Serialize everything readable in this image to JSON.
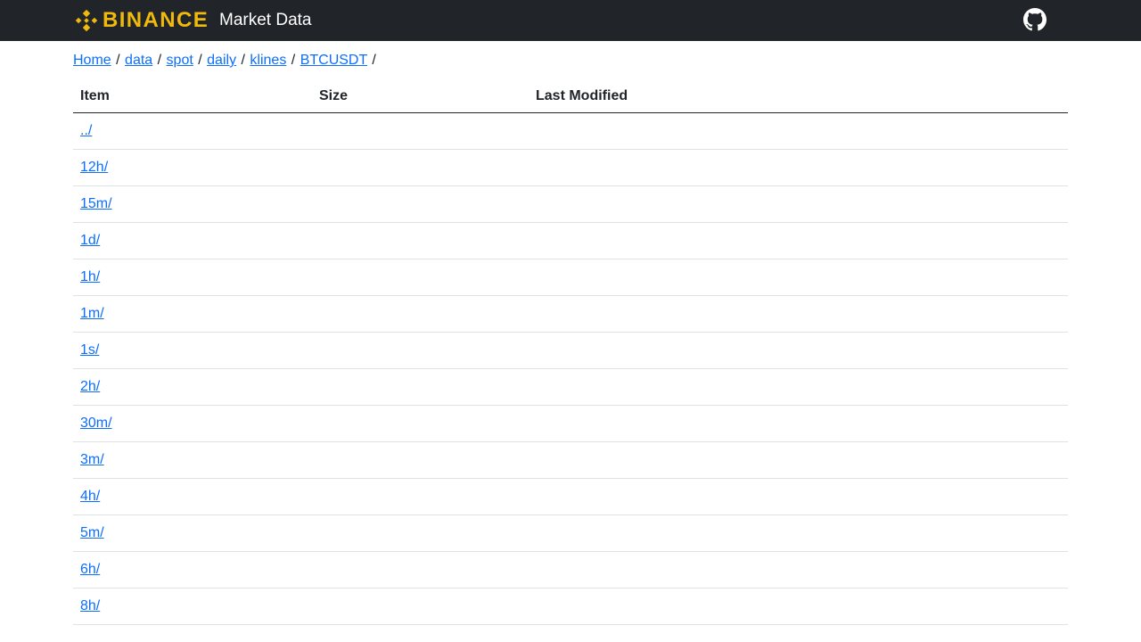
{
  "navbar": {
    "brand_word": "BINANCE",
    "brand_logo": "binance-diamond-logo",
    "title": "Market Data",
    "github_icon": "github-icon",
    "brand_color": "#F0B90B",
    "bg_color": "#212529"
  },
  "breadcrumb": [
    {
      "label": "Home"
    },
    {
      "label": "data"
    },
    {
      "label": "spot"
    },
    {
      "label": "daily"
    },
    {
      "label": "klines"
    },
    {
      "label": "BTCUSDT"
    }
  ],
  "breadcrumb_sep": "/",
  "table": {
    "headers": {
      "item": "Item",
      "size": "Size",
      "modified": "Last Modified"
    },
    "rows": [
      {
        "item": "../",
        "size": "",
        "modified": ""
      },
      {
        "item": "12h/",
        "size": "",
        "modified": ""
      },
      {
        "item": "15m/",
        "size": "",
        "modified": ""
      },
      {
        "item": "1d/",
        "size": "",
        "modified": ""
      },
      {
        "item": "1h/",
        "size": "",
        "modified": ""
      },
      {
        "item": "1m/",
        "size": "",
        "modified": ""
      },
      {
        "item": "1s/",
        "size": "",
        "modified": ""
      },
      {
        "item": "2h/",
        "size": "",
        "modified": ""
      },
      {
        "item": "30m/",
        "size": "",
        "modified": ""
      },
      {
        "item": "3m/",
        "size": "",
        "modified": ""
      },
      {
        "item": "4h/",
        "size": "",
        "modified": ""
      },
      {
        "item": "5m/",
        "size": "",
        "modified": ""
      },
      {
        "item": "6h/",
        "size": "",
        "modified": ""
      },
      {
        "item": "8h/",
        "size": "",
        "modified": ""
      }
    ]
  },
  "link_color": "#0d6efd"
}
